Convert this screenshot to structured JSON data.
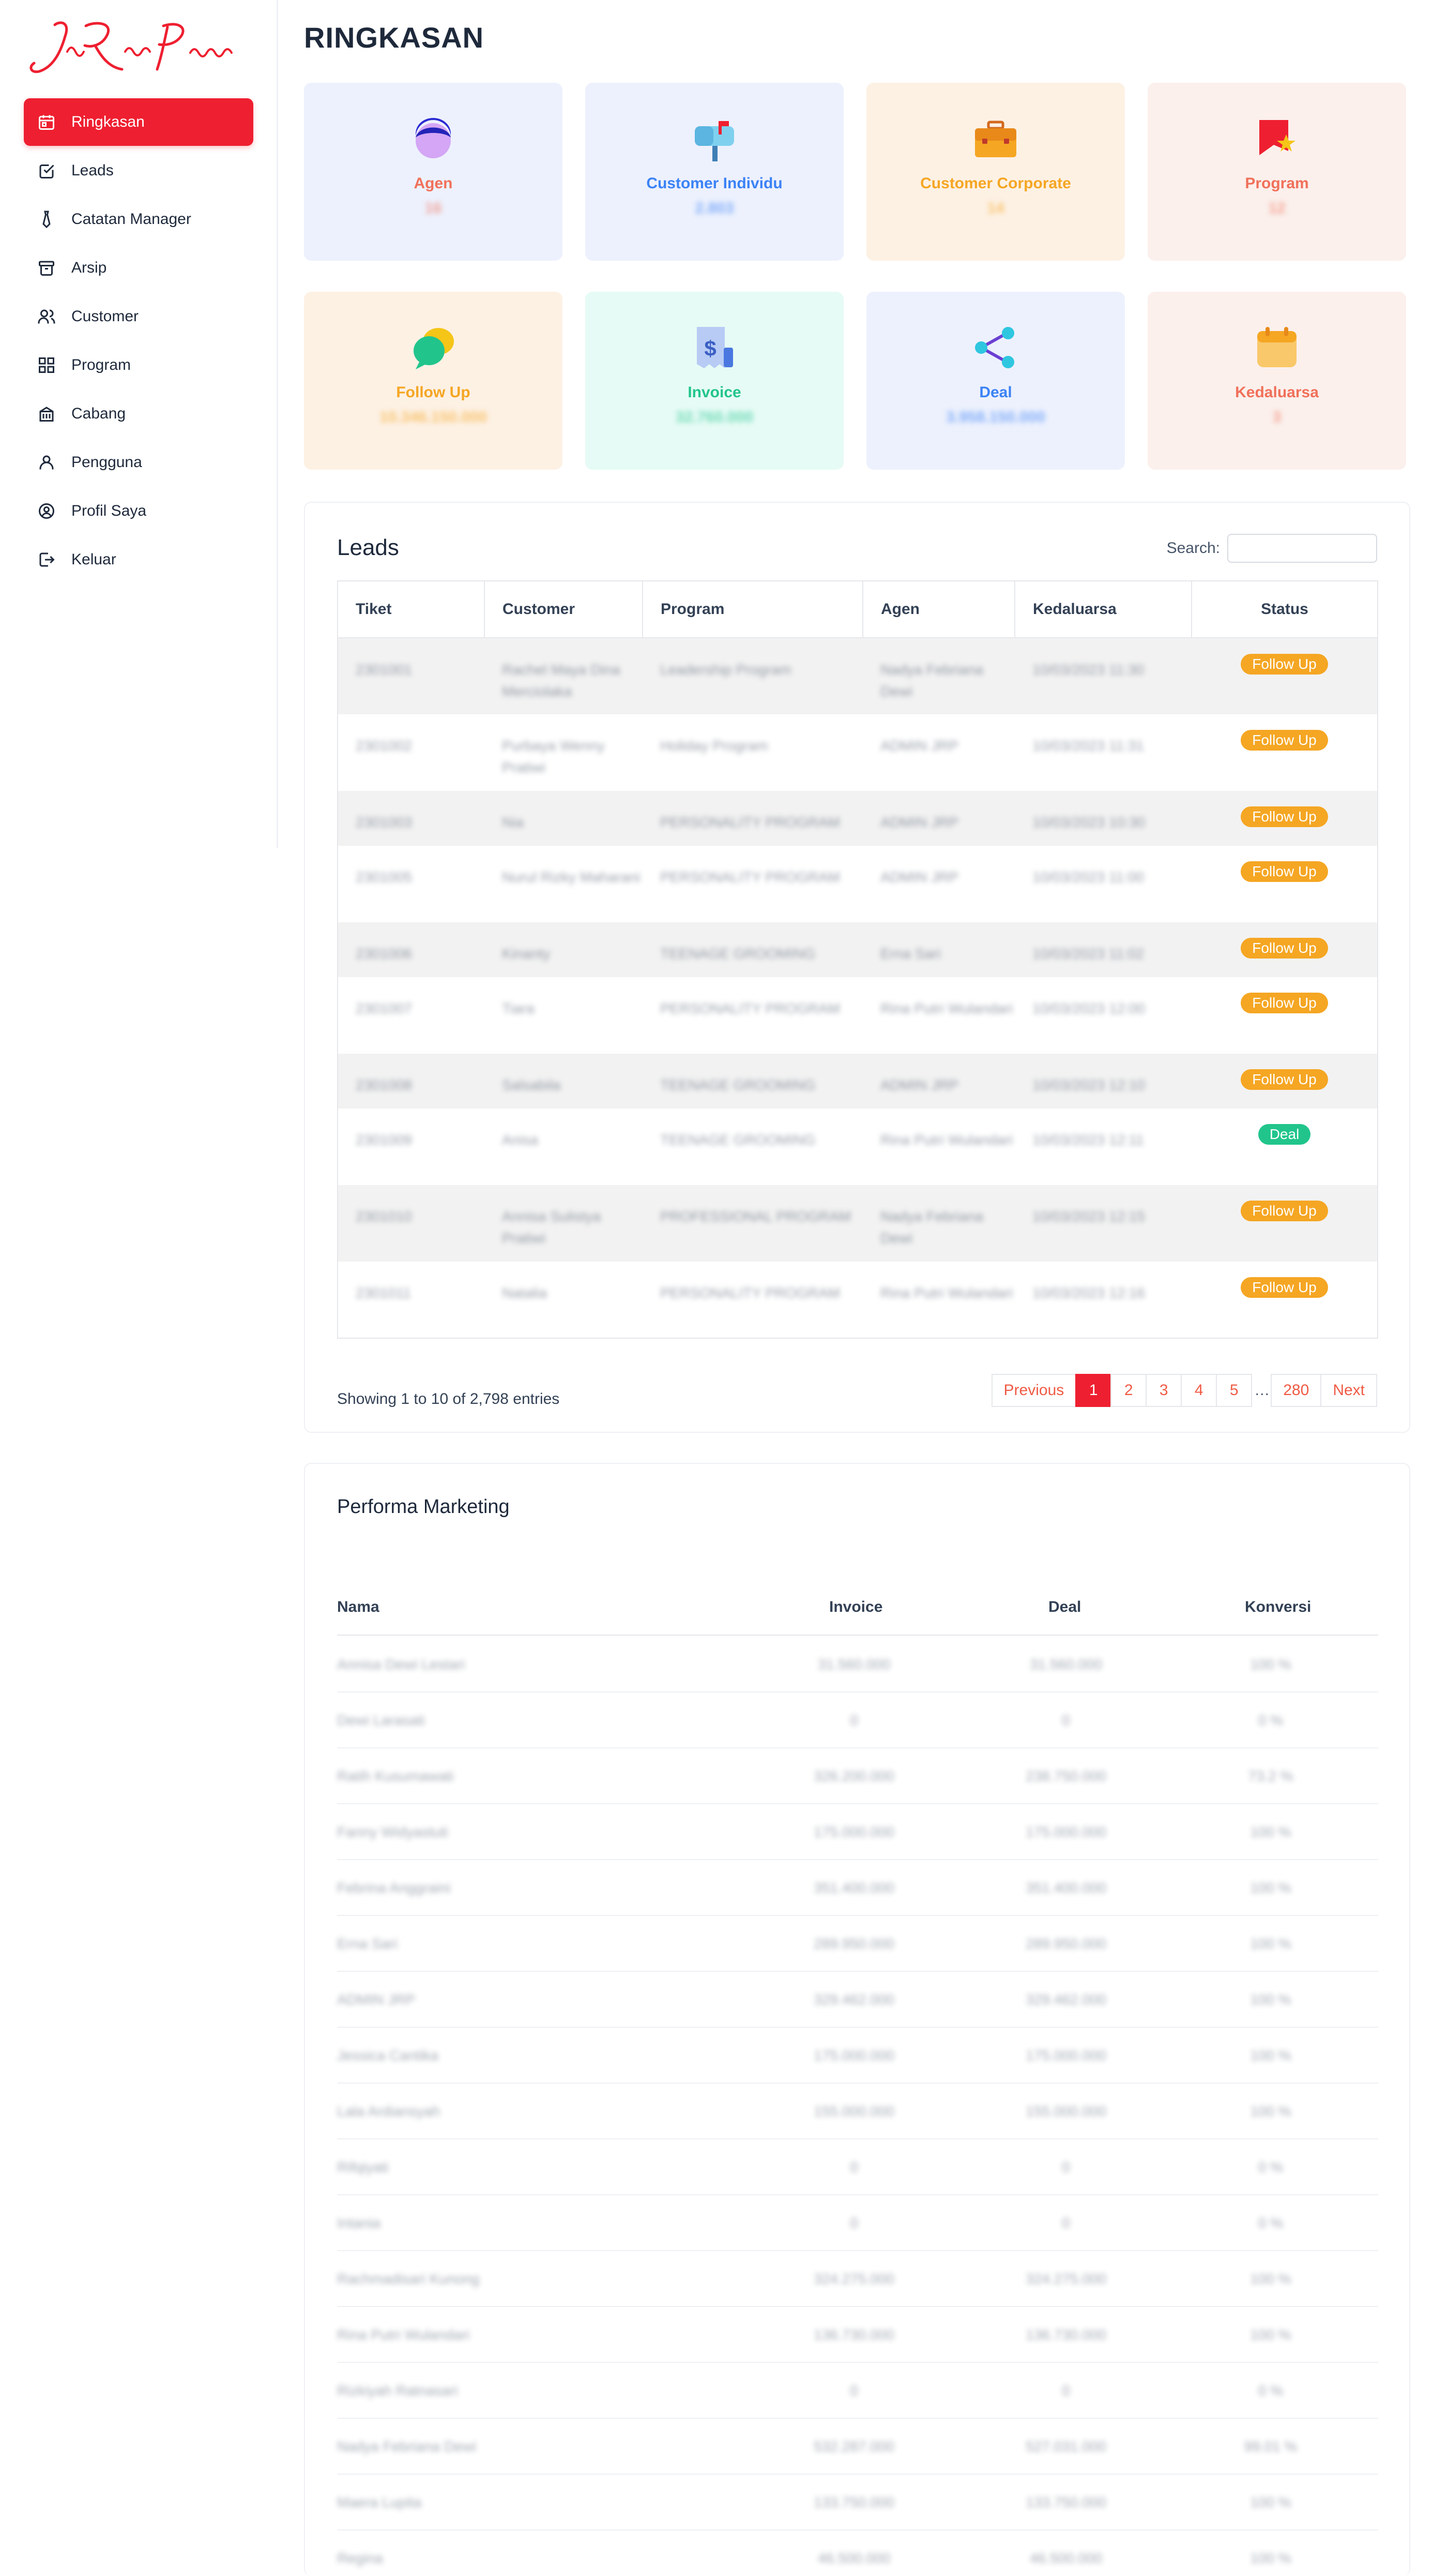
{
  "brand": {
    "name": "John Robert Powers",
    "color": "#ee1f30"
  },
  "sidebar": {
    "items": [
      {
        "label": "Ringkasan",
        "icon": "calendar-icon",
        "active": true
      },
      {
        "label": "Leads",
        "icon": "checkbox-icon",
        "active": false
      },
      {
        "label": "Catatan Manager",
        "icon": "tie-icon",
        "active": false
      },
      {
        "label": "Arsip",
        "icon": "archive-icon",
        "active": false
      },
      {
        "label": "Customer",
        "icon": "users-icon",
        "active": false
      },
      {
        "label": "Program",
        "icon": "grid-icon",
        "active": false
      },
      {
        "label": "Cabang",
        "icon": "building-icon",
        "active": false
      },
      {
        "label": "Pengguna",
        "icon": "user-icon",
        "active": false
      },
      {
        "label": "Profil Saya",
        "icon": "user-circle-icon",
        "active": false
      },
      {
        "label": "Keluar",
        "icon": "logout-icon",
        "active": false
      }
    ]
  },
  "page": {
    "title": "RINGKASAN"
  },
  "stats": [
    {
      "label": "Agen",
      "value": "16",
      "icon": "agent-avatar-icon",
      "bg": "#edf1fd",
      "color": "#f0705a"
    },
    {
      "label": "Customer Individu",
      "value": "2.803",
      "icon": "mailbox-icon",
      "bg": "#edf1fd",
      "color": "#3b82f6"
    },
    {
      "label": "Customer Corporate",
      "value": "14",
      "icon": "briefcase-icon",
      "bg": "#fdf1e4",
      "color": "#f5a623"
    },
    {
      "label": "Program",
      "value": "12",
      "icon": "flag-star-icon",
      "bg": "#fbf0ec",
      "color": "#f0705a"
    },
    {
      "label": "Follow Up",
      "value": "10.346.150.000",
      "icon": "chat-bubbles-icon",
      "bg": "#fdf1e4",
      "color": "#f5a623"
    },
    {
      "label": "Invoice",
      "value": "32.760.000",
      "icon": "invoice-icon",
      "bg": "#e6fbf5",
      "color": "#21c58c"
    },
    {
      "label": "Deal",
      "value": "3.958.150.000",
      "icon": "share-nodes-icon",
      "bg": "#edf1fd",
      "color": "#3b82f6"
    },
    {
      "label": "Kedaluarsa",
      "value": "3",
      "icon": "calendar-expired-icon",
      "bg": "#fbf0ec",
      "color": "#f0705a"
    }
  ],
  "leads": {
    "title": "Leads",
    "search_label": "Search:",
    "search_value": "",
    "columns": [
      "Tiket",
      "Customer",
      "Program",
      "Agen",
      "Kedaluarsa",
      "Status"
    ],
    "rows": [
      {
        "tiket": "2301001",
        "customer": "Rachel Maya Dina Merciolaka",
        "program": "Leadership Program",
        "agen": "Nadya Febriana Dewi",
        "kedaluarsa": "10/03/2023 11:30",
        "status": "Follow Up"
      },
      {
        "tiket": "2301002",
        "customer": "Purbaya Wenny Pratiwi",
        "program": "Holiday Program",
        "agen": "ADMIN JRP",
        "kedaluarsa": "10/03/2023 11:31",
        "status": "Follow Up"
      },
      {
        "tiket": "2301003",
        "customer": "Nia",
        "program": "PERSONALITY PROGRAM",
        "agen": "ADMIN JRP",
        "kedaluarsa": "10/03/2023 10:30",
        "status": "Follow Up"
      },
      {
        "tiket": "2301005",
        "customer": "Nurul Rizky Maharani",
        "program": "PERSONALITY PROGRAM",
        "agen": "ADMIN JRP",
        "kedaluarsa": "10/03/2023 11:00",
        "status": "Follow Up"
      },
      {
        "tiket": "2301006",
        "customer": "Kinanty",
        "program": "TEENAGE GROOMING",
        "agen": "Erna Sari",
        "kedaluarsa": "10/03/2023 11:02",
        "status": "Follow Up"
      },
      {
        "tiket": "2301007",
        "customer": "Tiara",
        "program": "PERSONALITY PROGRAM",
        "agen": "Rina Putri Wulandari",
        "kedaluarsa": "10/03/2023 12:00",
        "status": "Follow Up"
      },
      {
        "tiket": "2301008",
        "customer": "Salsabila",
        "program": "TEENAGE GROOMING",
        "agen": "ADMIN JRP",
        "kedaluarsa": "10/03/2023 12:10",
        "status": "Follow Up"
      },
      {
        "tiket": "2301009",
        "customer": "Anisa",
        "program": "TEENAGE GROOMING",
        "agen": "Rina Putri Wulandari",
        "kedaluarsa": "10/03/2023 12:11",
        "status": "Deal"
      },
      {
        "tiket": "2301010",
        "customer": "Annisa Sulistya Pratiwi",
        "program": "PROFESSIONAL PROGRAM",
        "agen": "Nadya Febriana Dewi",
        "kedaluarsa": "10/03/2023 12:15",
        "status": "Follow Up"
      },
      {
        "tiket": "2301011",
        "customer": "Natalia",
        "program": "PERSONALITY PROGRAM",
        "agen": "Rina Putri Wulandari",
        "kedaluarsa": "10/03/2023 12:16",
        "status": "Follow Up"
      }
    ],
    "showing": "Showing 1 to 10 of 2,798 entries",
    "pagination": {
      "previous": "Previous",
      "pages": [
        "1",
        "2",
        "3",
        "4",
        "5"
      ],
      "ellipsis": "…",
      "last": "280",
      "next": "Next"
    }
  },
  "performa": {
    "title": "Performa Marketing",
    "columns": [
      "Nama",
      "Invoice",
      "Deal",
      "Konversi"
    ],
    "rows": [
      {
        "nama": "Annisa Dewi Lestari",
        "invoice": "31.560.000",
        "deal": "31.560.000",
        "konversi": "100 %"
      },
      {
        "nama": "Dewi Larasati",
        "invoice": "0",
        "deal": "0",
        "konversi": "0 %"
      },
      {
        "nama": "Ratih Kusumawati",
        "invoice": "326.200.000",
        "deal": "238.750.000",
        "konversi": "73.2 %"
      },
      {
        "nama": "Fanny Widyastuti",
        "invoice": "175.000.000",
        "deal": "175.000.000",
        "konversi": "100 %"
      },
      {
        "nama": "Febrina Anggraini",
        "invoice": "351.400.000",
        "deal": "351.400.000",
        "konversi": "100 %"
      },
      {
        "nama": "Erna Sari",
        "invoice": "289.950.000",
        "deal": "289.950.000",
        "konversi": "100 %"
      },
      {
        "nama": "ADMIN JRP",
        "invoice": "329.462.000",
        "deal": "329.462.000",
        "konversi": "100 %"
      },
      {
        "nama": "Jessica Cantika",
        "invoice": "175.000.000",
        "deal": "175.000.000",
        "konversi": "100 %"
      },
      {
        "nama": "Lala Ardiansyah",
        "invoice": "155.000.000",
        "deal": "155.000.000",
        "konversi": "100 %"
      },
      {
        "nama": "Rifqiyati",
        "invoice": "0",
        "deal": "0",
        "konversi": "0 %"
      },
      {
        "nama": "Intania",
        "invoice": "0",
        "deal": "0",
        "konversi": "0 %"
      },
      {
        "nama": "Rachmadisari Kunong",
        "invoice": "324.275.000",
        "deal": "324.275.000",
        "konversi": "100 %"
      },
      {
        "nama": "Rina Putri Wulandari",
        "invoice": "136.730.000",
        "deal": "136.730.000",
        "konversi": "100 %"
      },
      {
        "nama": "Rizkiyah Ratnasari",
        "invoice": "0",
        "deal": "0",
        "konversi": "0 %"
      },
      {
        "nama": "Nadya Febriana Dewi",
        "invoice": "532.287.000",
        "deal": "527.031.000",
        "konversi": "99.01 %"
      },
      {
        "nama": "Maera Lupita",
        "invoice": "133.750.000",
        "deal": "133.750.000",
        "konversi": "100 %"
      },
      {
        "nama": "Regina",
        "invoice": "46.500.000",
        "deal": "46.500.000",
        "konversi": "100 %"
      }
    ]
  }
}
